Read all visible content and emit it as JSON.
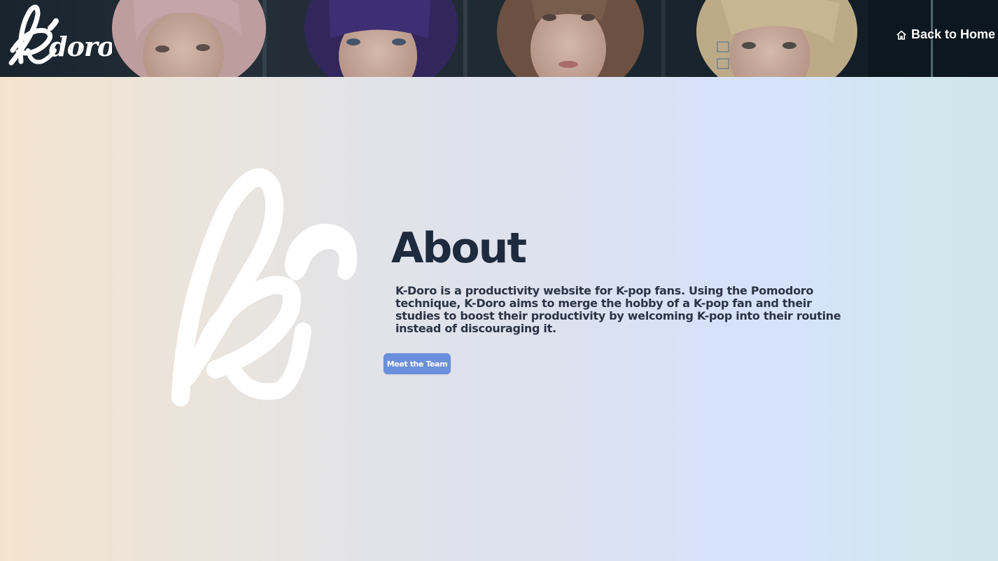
{
  "header": {
    "logo_text": "kdoro",
    "home_link_label": "Back to Home",
    "home_icon": "home-icon"
  },
  "main": {
    "logo_letter": "k",
    "title": "About",
    "description": "K-Doro is a productivity website for K-pop fans. Using the Pomodoro technique, K-Doro aims to merge the hobby of a K-pop fan and their studies to boost their productivity by welcoming K-pop into their routine instead of discouraging it.",
    "team_button_label": "Meet the Team"
  },
  "colors": {
    "accent": "#6a8fdc",
    "title": "#1e2a3d",
    "text": "#2b3445",
    "header_bg": "#1c2630"
  }
}
